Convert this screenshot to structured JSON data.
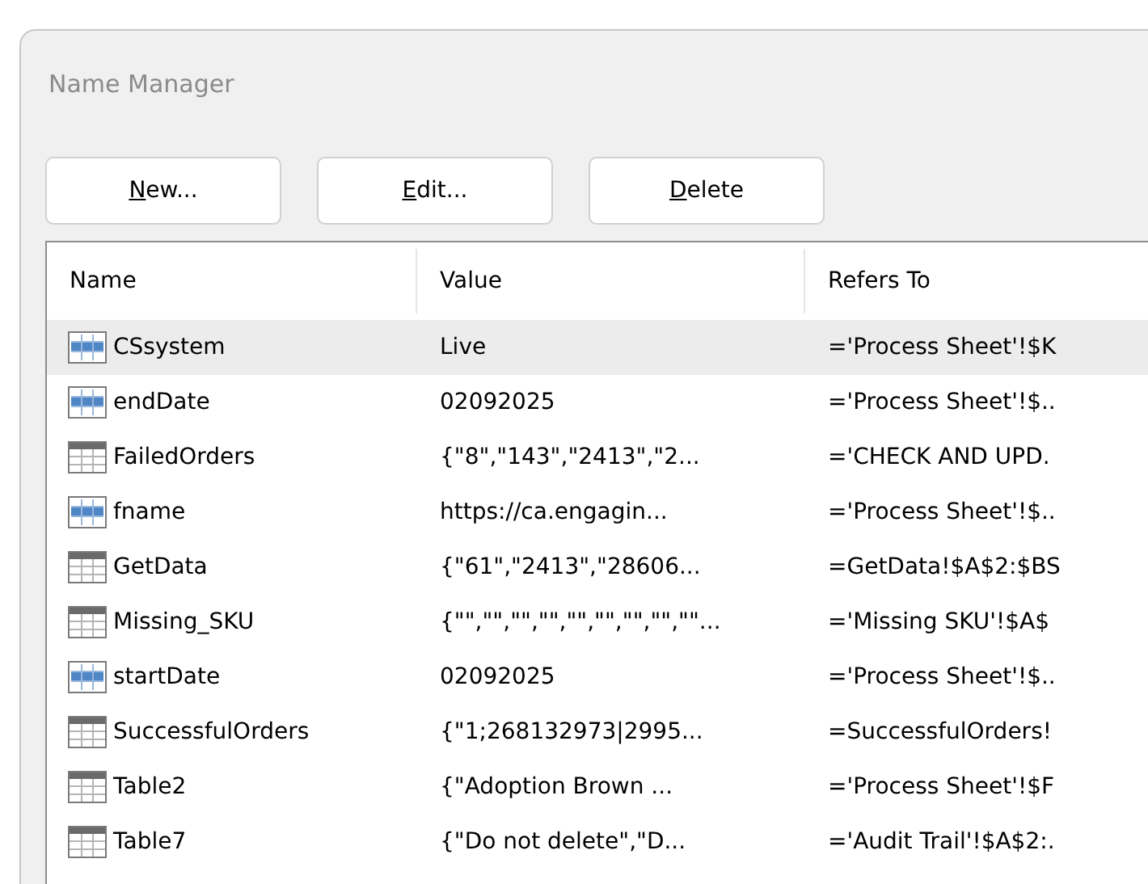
{
  "window": {
    "title": "Name Manager"
  },
  "buttons": [
    {
      "accel": "N",
      "rest": "ew..."
    },
    {
      "accel": "E",
      "rest": "dit..."
    },
    {
      "accel": "D",
      "rest": "elete"
    }
  ],
  "table": {
    "columns": [
      "Name",
      "Value",
      "Refers To"
    ],
    "rows": [
      {
        "kind": "range",
        "name": "CSsystem",
        "value": "Live",
        "refers_to": "='Process Sheet'!$K",
        "selected": true
      },
      {
        "kind": "range",
        "name": "endDate",
        "value": "02092025",
        "refers_to": "='Process Sheet'!$..",
        "selected": false
      },
      {
        "kind": "table",
        "name": "FailedOrders",
        "value": "{\"8\",\"143\",\"2413\",\"2...",
        "refers_to": "='CHECK AND UPD.",
        "selected": false
      },
      {
        "kind": "range",
        "name": "fname",
        "value": "https://ca.engagin...",
        "refers_to": "='Process Sheet'!$..",
        "selected": false
      },
      {
        "kind": "table",
        "name": "GetData",
        "value": "{\"61\",\"2413\",\"28606...",
        "refers_to": "=GetData!$A$2:$BS",
        "selected": false
      },
      {
        "kind": "table",
        "name": "Missing_SKU",
        "value": "{\"\",\"\",\"\",\"\",\"\",\"\",\"\",\"\",\"\"...",
        "refers_to": "='Missing SKU'!$A$",
        "selected": false
      },
      {
        "kind": "range",
        "name": "startDate",
        "value": "02092025",
        "refers_to": "='Process Sheet'!$..",
        "selected": false
      },
      {
        "kind": "table",
        "name": "SuccessfulOrders",
        "value": "{\"1;268132973|2995...",
        "refers_to": "=SuccessfulOrders!",
        "selected": false
      },
      {
        "kind": "table",
        "name": "Table2",
        "value": "{\"Adoption Brown ...",
        "refers_to": "='Process Sheet'!$F",
        "selected": false
      },
      {
        "kind": "table",
        "name": "Table7",
        "value": "{\"Do not delete\",\"D...",
        "refers_to": "='Audit Trail'!$A$2:.",
        "selected": false
      }
    ]
  }
}
